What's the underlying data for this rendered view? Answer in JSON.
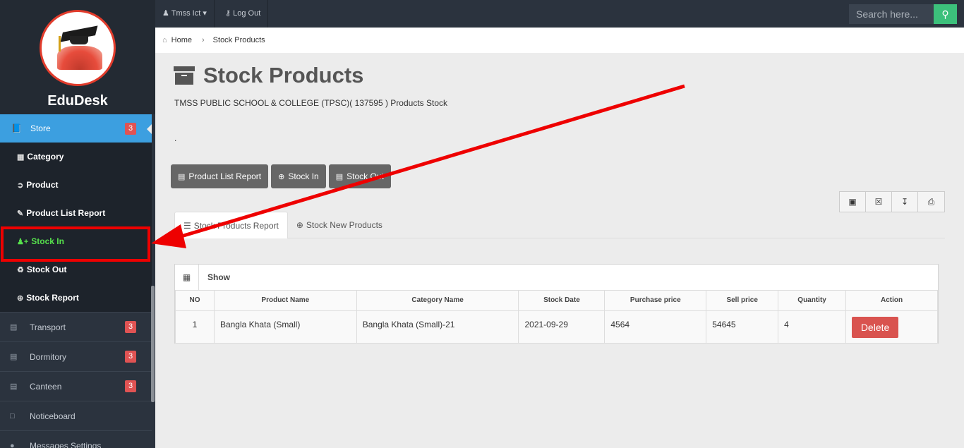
{
  "brand": {
    "name": "EduDesk"
  },
  "sidebar": {
    "store": {
      "label": "Store",
      "badge": "3"
    },
    "submenu": [
      {
        "label": "Category",
        "icon": "th-large-icon"
      },
      {
        "label": "Product",
        "icon": "product-icon"
      },
      {
        "label": "Product List Report",
        "icon": "book-edit-icon"
      },
      {
        "label": "Stock In",
        "icon": "user-plus-icon"
      },
      {
        "label": "Stock Out",
        "icon": "recycle-icon"
      },
      {
        "label": "Stock Report",
        "icon": "plus-circle-icon"
      }
    ],
    "items": [
      {
        "label": "Transport",
        "badge": "3"
      },
      {
        "label": "Dormitory",
        "badge": "3"
      },
      {
        "label": "Canteen",
        "badge": "3"
      },
      {
        "label": "Noticeboard"
      },
      {
        "label": "Messages Settings"
      }
    ]
  },
  "topbar": {
    "user": "Tmss Ict",
    "logout": "Log Out",
    "search_placeholder": "Search here..."
  },
  "breadcrumb": {
    "home": "Home",
    "current": "Stock Products"
  },
  "page": {
    "title": "Stock Products",
    "subtitle": "TMSS PUBLIC SCHOOL & COLLEGE (TPSC)( 137595 ) Products Stock",
    "dot": "."
  },
  "buttons": {
    "product_list_report": "Product List Report",
    "stock_in": "Stock In",
    "stock_out": "Stock Out"
  },
  "tabs": {
    "report": "Stock Products Report",
    "new": "Stock New Products"
  },
  "panel": {
    "show": "Show"
  },
  "table": {
    "headers": [
      "NO",
      "Product Name",
      "Category Name",
      "Stock Date",
      "Purchase price",
      "Sell price",
      "Quantity",
      "Action"
    ],
    "rows": [
      {
        "no": "1",
        "product": "Bangla Khata (Small)",
        "category": "Bangla Khata (Small)-21",
        "date": "2021-09-29",
        "purchase": "4564",
        "sell": "54645",
        "qty": "4",
        "action": "Delete"
      }
    ]
  },
  "colors": {
    "sidebar_bg": "#2b333e",
    "store_active": "#3c9fe0",
    "stock_in_active": "#56e04c",
    "badge": "#e05353",
    "search_button": "#3cc07b",
    "delete_button": "#d9534f",
    "annotation": "#ee0000"
  }
}
